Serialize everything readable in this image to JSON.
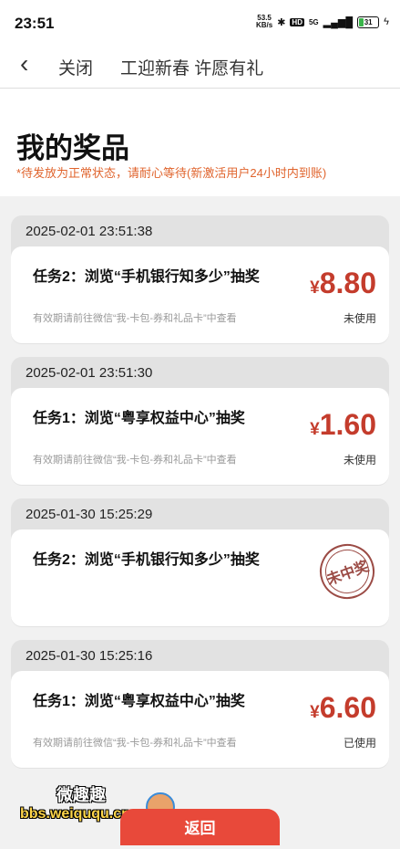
{
  "status_bar": {
    "time": "23:51",
    "net_speed_value": "53.5",
    "net_speed_unit": "KB/s",
    "hd": "HD",
    "signal_label": "5G",
    "battery": "31"
  },
  "nav": {
    "close_label": "关闭",
    "title": "工迎新春 许愿有礼"
  },
  "header": {
    "title": "我的奖品",
    "notice": "*待发放为正常状态，请耐心等待(新激活用户24小时内到账)"
  },
  "records": [
    {
      "date": "2025-02-01 23:51:38",
      "task": "任务2：浏览“手机银行知多少”抽奖",
      "hint": "有效期请前往微信“我-卡包-券和礼品卡”中查看",
      "currency": "¥",
      "amount": "8.80",
      "status": "未使用"
    },
    {
      "date": "2025-02-01 23:51:30",
      "task": "任务1：浏览“粤享权益中心”抽奖",
      "hint": "有效期请前往微信“我-卡包-券和礼品卡”中查看",
      "currency": "¥",
      "amount": "1.60",
      "status": "未使用"
    },
    {
      "date": "2025-01-30 15:25:29",
      "task": "任务2：浏览“手机银行知多少”抽奖",
      "stamp": "未中奖"
    },
    {
      "date": "2025-01-30 15:25:16",
      "task": "任务1：浏览“粤享权益中心”抽奖",
      "hint": "有效期请前往微信“我-卡包-券和礼品卡”中查看",
      "currency": "¥",
      "amount": "6.60",
      "status": "已使用"
    }
  ],
  "watermark": {
    "line1": "微趣趣",
    "line2": "bbs.weiququ.cn"
  },
  "footer": {
    "return_label": "返回"
  },
  "colors": {
    "accent": "#c43c2c",
    "notice": "#e0642d",
    "button": "#e8493a"
  }
}
